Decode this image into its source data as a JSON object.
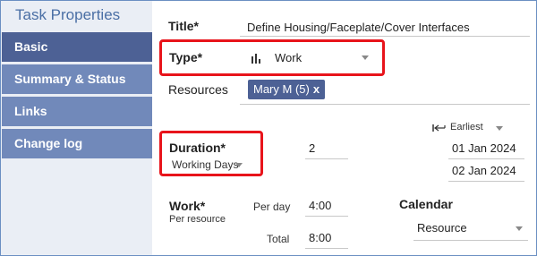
{
  "sidebar": {
    "title": "Task Properties",
    "items": [
      {
        "label": "Basic",
        "active": true
      },
      {
        "label": "Summary & Status",
        "active": false
      },
      {
        "label": "Links",
        "active": false
      },
      {
        "label": "Change log",
        "active": false
      }
    ]
  },
  "form": {
    "title_label": "Title*",
    "title_value": "Define Housing/Faceplate/Cover Interfaces",
    "type_label": "Type*",
    "type_value": "Work",
    "resources_label": "Resources",
    "resource_chip": "Mary M (5)",
    "resource_chip_remove": "x",
    "duration_label": "Duration*",
    "duration_unit": "Working Days",
    "duration_value": "2",
    "schedule_mode": "Earliest",
    "start_date": "01 Jan 2024",
    "end_date": "02 Jan 2024",
    "work_label": "Work*",
    "work_sublabel": "Per resource",
    "per_day_label": "Per day",
    "per_day_value": "4:00",
    "total_label": "Total",
    "total_value": "8:00",
    "calendar_label": "Calendar",
    "calendar_value": "Resource"
  },
  "colors": {
    "sidebar_active": "#4d6195",
    "sidebar_item": "#7189ba",
    "highlight_box": "#e8141b",
    "title_blue": "#4a6fa5"
  }
}
